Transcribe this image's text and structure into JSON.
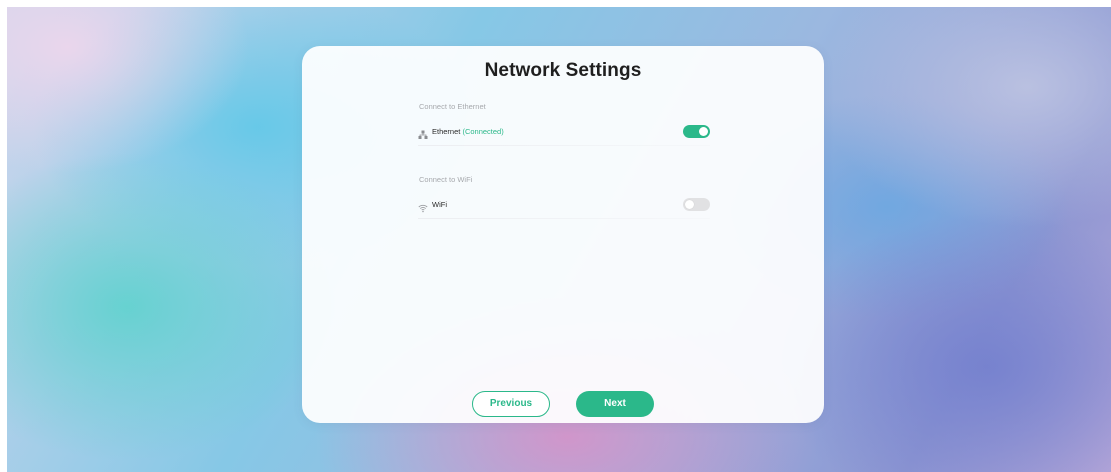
{
  "dialog": {
    "title": "Network Settings"
  },
  "ethernet": {
    "section_label": "Connect to Ethernet",
    "name": "Ethernet",
    "status": "(Connected)",
    "icon": "network-icon",
    "enabled": true
  },
  "wifi": {
    "section_label": "Connect to WiFi",
    "name": "WiFi",
    "icon": "wifi-icon",
    "enabled": false
  },
  "footer": {
    "previous_label": "Previous",
    "next_label": "Next"
  },
  "colors": {
    "accent": "#2bb88a",
    "toggle_off": "#e1e1e3",
    "title_text": "#1f1f1f",
    "section_label": "#a7a9ad"
  }
}
